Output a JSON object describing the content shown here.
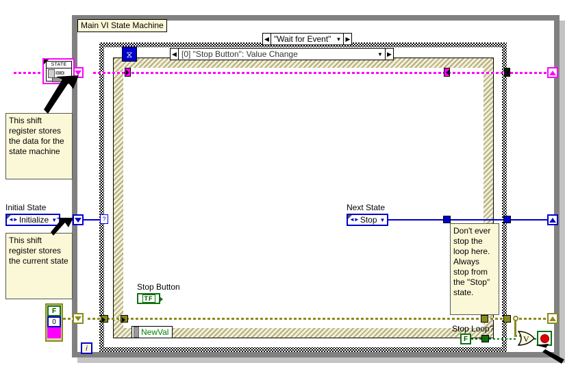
{
  "diagram": {
    "label": "Main VI State Machine",
    "iteration_terminal": "i"
  },
  "case_structure": {
    "selected_case": "\"Wait for Event\"",
    "left_arrow": "◀",
    "right_arrow": "▶",
    "dropdown": "▼",
    "selector_tunnel": "?"
  },
  "event_structure": {
    "selected_event": "[0] \"Stop Button\": Value Change",
    "left_arrow": "◀",
    "right_arrow": "▶",
    "dropdown": "▼",
    "timeout_icon": "⧖",
    "event_data_node": "NewVal"
  },
  "controls": {
    "initial_state": {
      "label": "Initial State",
      "value": "Initialize"
    },
    "next_state": {
      "label": "Next State",
      "value": "Stop"
    },
    "stop_button": {
      "label": "Stop Button",
      "terminal_text": "TF"
    },
    "stop_loop": {
      "label": "Stop Loop?",
      "value": "F"
    }
  },
  "state_cluster_icon": {
    "title": "STATE",
    "bits": "I0II0I"
  },
  "cluster_constant": {
    "boolean": "F",
    "numeric": "0",
    "string": ""
  },
  "comments": [
    {
      "id": "comment-shift-register-data",
      "text": "This shift register stores the data for the state machine"
    },
    {
      "id": "comment-shift-register-state",
      "text": "This shift register stores the current state"
    },
    {
      "id": "comment-stop-loop-warning",
      "text": "Don't ever stop the loop here. Always stop from the \"Stop\" state."
    }
  ],
  "colors": {
    "wire_cluster": "#ff00ff",
    "wire_enum": "#0000cc",
    "wire_error": "#8a8a1a",
    "wire_boolean": "#008000",
    "structure_border": "#808080",
    "comment_bg": "#fbf8d8"
  }
}
